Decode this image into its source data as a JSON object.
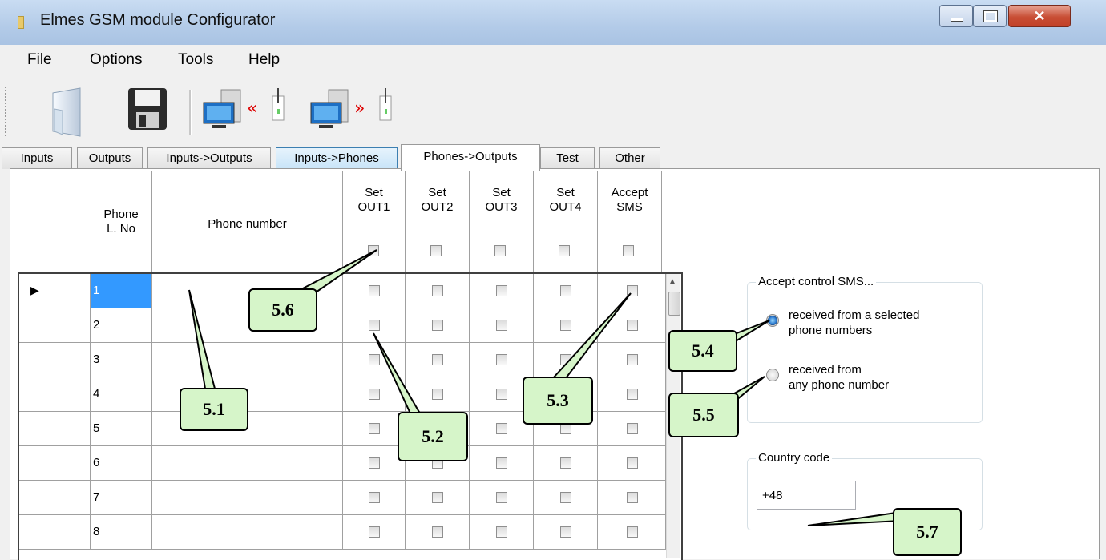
{
  "window": {
    "title": "Elmes GSM module Configurator"
  },
  "menu": [
    "File",
    "Options",
    "Tools",
    "Help"
  ],
  "toolbar": {
    "icons": [
      "open-file-icon",
      "save-floppy-icon",
      "download-from-module-icon",
      "upload-to-module-icon"
    ]
  },
  "tabs": [
    "Inputs",
    "Outputs",
    "Inputs->Outputs",
    "Inputs->Phones",
    "Phones->Outputs",
    "Test",
    "Other"
  ],
  "active_tab": "Phones->Outputs",
  "grid": {
    "headers": {
      "phone_lno": [
        "Phone",
        "L. No"
      ],
      "phone_number": "Phone number",
      "set_out1": [
        "Set",
        "OUT1"
      ],
      "set_out2": [
        "Set",
        "OUT2"
      ],
      "set_out3": [
        "Set",
        "OUT3"
      ],
      "set_out4": [
        "Set",
        "OUT4"
      ],
      "accept_sms": [
        "Accept",
        "SMS"
      ]
    },
    "rows": [
      "1",
      "2",
      "3",
      "4",
      "5",
      "6",
      "7",
      "8"
    ]
  },
  "sms_group": {
    "label": "Accept control SMS...",
    "option_selected": [
      "received from a selected",
      "phone numbers"
    ],
    "option_any": [
      "received from",
      "any phone number"
    ]
  },
  "country_group": {
    "label": "Country code",
    "value": "+48"
  },
  "callouts": {
    "c51": "5.1",
    "c52": "5.2",
    "c53": "5.3",
    "c54": "5.4",
    "c55": "5.5",
    "c56": "5.6",
    "c57": "5.7"
  },
  "colors": {
    "callout_fill": "#d6f5c9",
    "selection": "#3399ff",
    "title_bar": "#b3cbe8"
  }
}
